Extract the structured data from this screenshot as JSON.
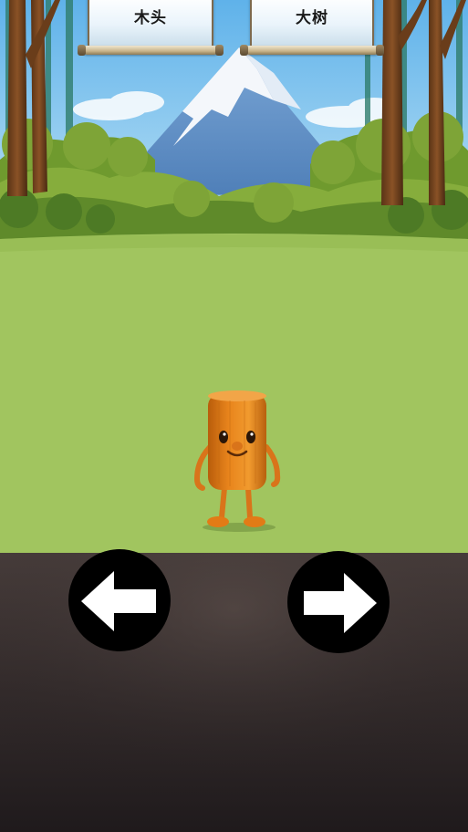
{
  "signs": {
    "left_word": "木头",
    "right_word": "大树"
  },
  "controls": {
    "left_icon": "arrow-left-icon",
    "right_icon": "arrow-right-icon"
  },
  "colors": {
    "sky": "#7cc3ee",
    "mountain": "#6f9fd0",
    "grass": "#a1c55f",
    "ground": "#2e2727",
    "character": "#e27b16",
    "button": "#000000"
  }
}
